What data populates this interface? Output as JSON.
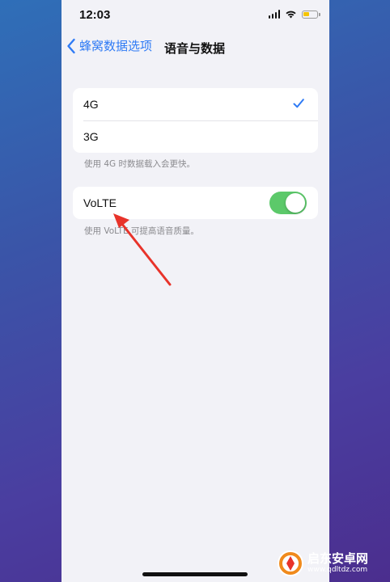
{
  "status_bar": {
    "time": "12:03"
  },
  "nav": {
    "back_label": "蜂窝数据选项",
    "title": "语音与数据"
  },
  "network_options": [
    {
      "label": "4G",
      "selected": true
    },
    {
      "label": "3G",
      "selected": false
    }
  ],
  "network_footnote": "使用 4G 时数据载入会更快。",
  "volte": {
    "label": "VoLTE",
    "enabled": true
  },
  "volte_footnote": "使用 VoLTE 可提高语音质量。",
  "colors": {
    "accent": "#2f7bf5",
    "toggle_on": "#5cc96a",
    "annotation_arrow": "#e8332a"
  },
  "watermark": {
    "title": "启东安卓网",
    "url": "www.qdltdz.com"
  }
}
